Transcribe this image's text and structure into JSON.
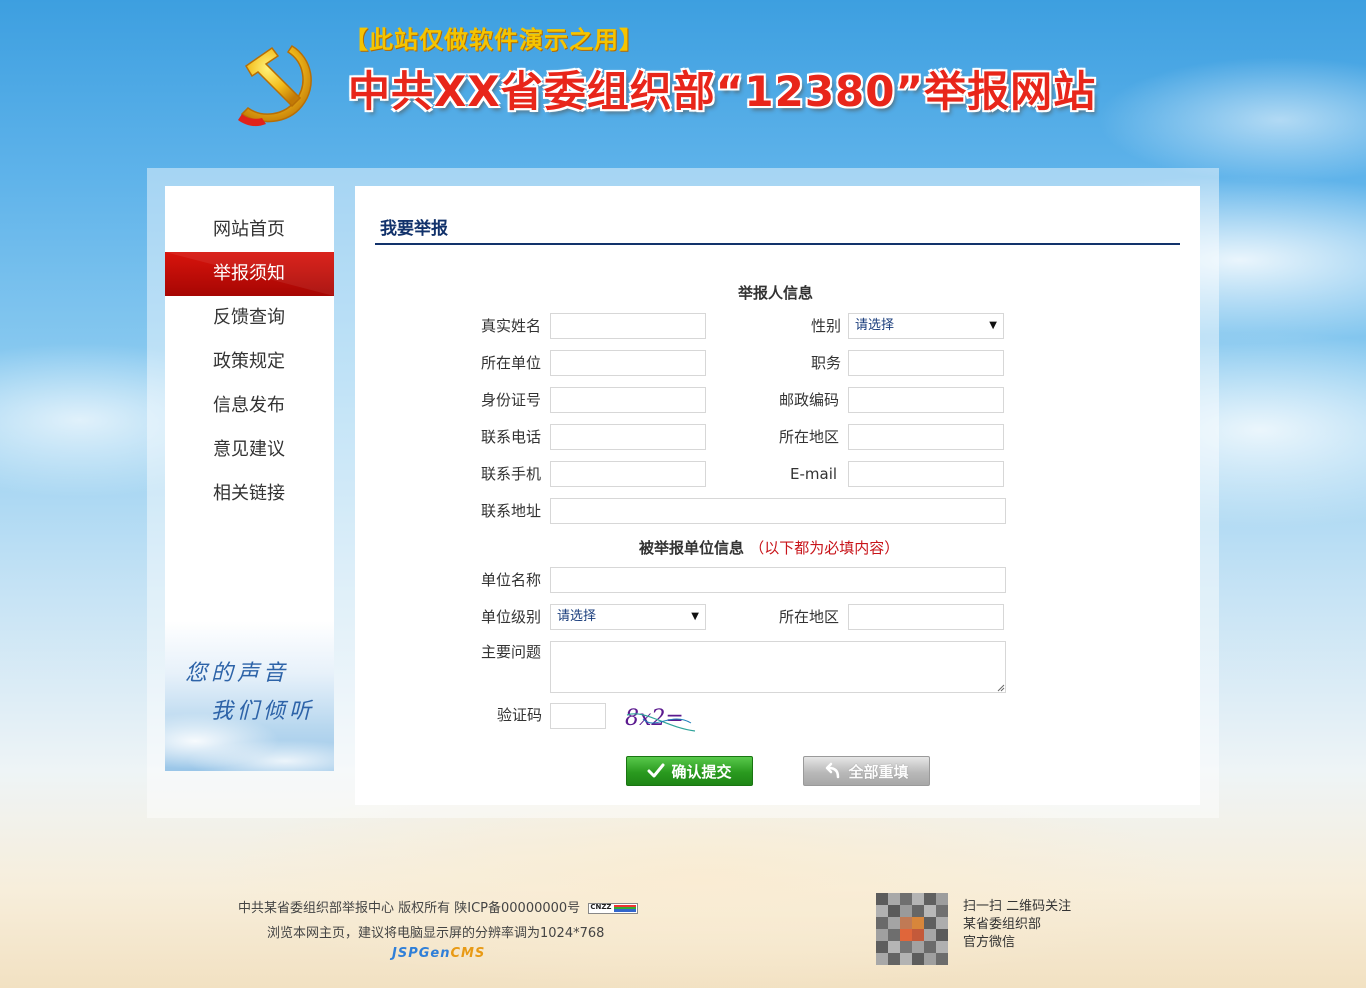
{
  "header": {
    "demo_notice": "【此站仅做软件演示之用】",
    "site_title": "中共XX省委组织部“12380”举报网站"
  },
  "sidebar": {
    "items": [
      {
        "label": "网站首页",
        "active": false
      },
      {
        "label": "举报须知",
        "active": true
      },
      {
        "label": "反馈查询",
        "active": false
      },
      {
        "label": "政策规定",
        "active": false
      },
      {
        "label": "信息发布",
        "active": false
      },
      {
        "label": "意见建议",
        "active": false
      },
      {
        "label": "相关链接",
        "active": false
      }
    ],
    "slogan_line1": "您的声音",
    "slogan_line2": "我们倾听"
  },
  "main": {
    "title": "我要举报",
    "reporter_section": {
      "title": "举报人信息",
      "real_name_label": "真实姓名",
      "gender_label": "性别",
      "gender_value": "请选择",
      "organization_label": "所在单位",
      "position_label": "职务",
      "id_number_label": "身份证号",
      "postal_code_label": "邮政编码",
      "phone_label": "联系电话",
      "region_label": "所在地区",
      "mobile_label": "联系手机",
      "email_label": "E-mail",
      "address_label": "联系地址"
    },
    "reported_section": {
      "title": "被举报单位信息",
      "required_note": "（以下都为必填内容）",
      "unit_name_label": "单位名称",
      "unit_level_label": "单位级别",
      "unit_level_value": "请选择",
      "region_label": "所在地区",
      "main_issue_label": "主要问题",
      "captcha_label": "验证码",
      "captcha_text": "8x2="
    },
    "buttons": {
      "submit_label": "确认提交",
      "reset_label": "全部重填"
    }
  },
  "footer": {
    "copyright": "中共某省委组织部举报中心 版权所有 陕ICP备00000000号",
    "cnzz_badge": "CNZZ",
    "resolution_tip": "浏览本网主页，建议将电脑显示屏的分辨率调为1024*768",
    "cms_brand_main": "JSPGen",
    "cms_brand_suffix": "CMS",
    "qr_line1": "扫一扫 二维码关注",
    "qr_line2": "某省委组织部",
    "qr_line3": "官方微信"
  },
  "colors": {
    "accent_red": "#c8141a",
    "title_navy": "#12326b",
    "submit_green": "#2a9a1f",
    "reset_gray": "#b9b9b9"
  }
}
